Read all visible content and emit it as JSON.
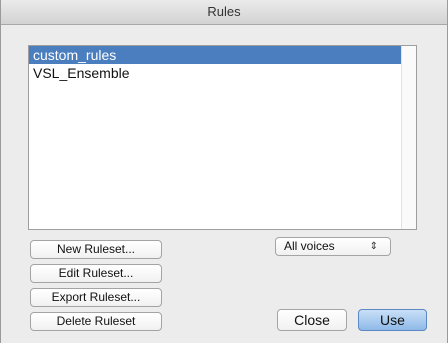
{
  "window": {
    "title": "Rules"
  },
  "rulesets": [
    "custom_rules",
    "VSL_Ensemble"
  ],
  "selected_index": 0,
  "buttons": {
    "new": "New Ruleset...",
    "edit": "Edit Ruleset...",
    "export": "Export Ruleset...",
    "delete": "Delete Ruleset",
    "close": "Close",
    "use": "Use"
  },
  "voices_select": {
    "value": "All voices",
    "icon": "updown-arrows-icon"
  }
}
